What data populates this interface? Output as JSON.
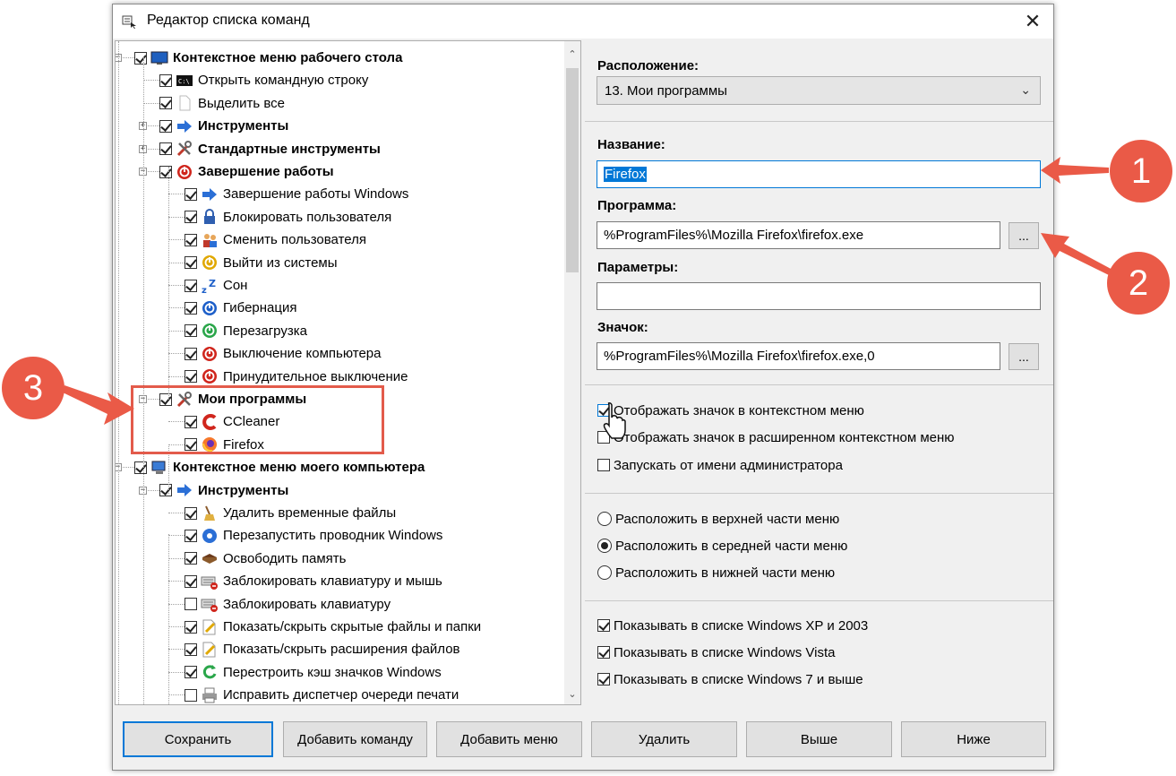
{
  "window": {
    "title": "Редактор списка команд",
    "close_glyph": "✕"
  },
  "tree": [
    {
      "label": "Контекстное меню рабочего стола",
      "bold": true,
      "checked": true,
      "level": 0,
      "expander": "−",
      "icon": "desktop-icon"
    },
    {
      "label": "Открыть командную строку",
      "bold": false,
      "checked": true,
      "level": 1,
      "icon": "cmd-icon"
    },
    {
      "label": "Выделить все",
      "bold": false,
      "checked": true,
      "level": 1,
      "icon": "document-icon"
    },
    {
      "label": "Инструменты",
      "bold": true,
      "checked": true,
      "level": 1,
      "expander": "+",
      "icon": "arrow-right-icon"
    },
    {
      "label": "Стандартные инструменты",
      "bold": true,
      "checked": true,
      "level": 1,
      "expander": "+",
      "icon": "tools-icon"
    },
    {
      "label": "Завершение работы",
      "bold": true,
      "checked": true,
      "level": 1,
      "expander": "−",
      "icon": "power-red-icon"
    },
    {
      "label": "Завершение работы Windows",
      "bold": false,
      "checked": true,
      "level": 2,
      "icon": "arrow-right-icon"
    },
    {
      "label": "Блокировать пользователя",
      "bold": false,
      "checked": true,
      "level": 2,
      "icon": "lock-icon"
    },
    {
      "label": "Сменить пользователя",
      "bold": false,
      "checked": true,
      "level": 2,
      "icon": "users-icon"
    },
    {
      "label": "Выйти из системы",
      "bold": false,
      "checked": true,
      "level": 2,
      "icon": "power-yellow-icon"
    },
    {
      "label": "Сон",
      "bold": false,
      "checked": true,
      "level": 2,
      "icon": "sleep-icon"
    },
    {
      "label": "Гибернация",
      "bold": false,
      "checked": true,
      "level": 2,
      "icon": "power-blue-icon"
    },
    {
      "label": "Перезагрузка",
      "bold": false,
      "checked": true,
      "level": 2,
      "icon": "power-green-icon"
    },
    {
      "label": "Выключение компьютера",
      "bold": false,
      "checked": true,
      "level": 2,
      "icon": "power-red-icon"
    },
    {
      "label": "Принудительное выключение",
      "bold": false,
      "checked": true,
      "level": 2,
      "icon": "power-red-icon"
    },
    {
      "label": "Мои программы",
      "bold": true,
      "checked": true,
      "level": 1,
      "expander": "−",
      "icon": "tools-icon"
    },
    {
      "label": "CCleaner",
      "bold": false,
      "checked": true,
      "level": 2,
      "icon": "ccleaner-icon"
    },
    {
      "label": "Firefox",
      "bold": false,
      "checked": true,
      "level": 2,
      "icon": "firefox-icon",
      "selected": true
    },
    {
      "label": "Контекстное меню моего компьютера",
      "bold": true,
      "checked": true,
      "level": 0,
      "expander": "−",
      "icon": "computer-icon"
    },
    {
      "label": "Инструменты",
      "bold": true,
      "checked": true,
      "level": 1,
      "expander": "−",
      "icon": "arrow-right-icon"
    },
    {
      "label": "Удалить временные файлы",
      "bold": false,
      "checked": true,
      "level": 2,
      "icon": "broom-icon"
    },
    {
      "label": "Перезапустить проводник Windows",
      "bold": false,
      "checked": true,
      "level": 2,
      "icon": "gear-blue-icon"
    },
    {
      "label": "Освободить память",
      "bold": false,
      "checked": true,
      "level": 2,
      "icon": "memory-icon"
    },
    {
      "label": "Заблокировать клавиатуру и мышь",
      "bold": false,
      "checked": true,
      "level": 2,
      "icon": "keyboard-lock-icon"
    },
    {
      "label": "Заблокировать клавиатуру",
      "bold": false,
      "checked": false,
      "level": 2,
      "icon": "keyboard-lock-icon"
    },
    {
      "label": "Показать/скрыть скрытые файлы и папки",
      "bold": false,
      "checked": true,
      "level": 2,
      "icon": "file-edit-icon"
    },
    {
      "label": "Показать/скрыть расширения файлов",
      "bold": false,
      "checked": true,
      "level": 2,
      "icon": "file-edit-icon"
    },
    {
      "label": "Перестроить кэш значков Windows",
      "bold": false,
      "checked": true,
      "level": 2,
      "icon": "refresh-green-icon"
    },
    {
      "label": "Исправить диспетчер очереди печати",
      "bold": false,
      "checked": false,
      "level": 2,
      "icon": "printer-icon"
    }
  ],
  "form": {
    "location_label": "Расположение:",
    "location_value": "13. Мои программы",
    "name_label": "Название:",
    "name_value": "Firefox",
    "program_label": "Программа:",
    "program_value": "%ProgramFiles%\\Mozilla Firefox\\firefox.exe",
    "params_label": "Параметры:",
    "params_value": "",
    "icon_label": "Значок:",
    "icon_value": "%ProgramFiles%\\Mozilla Firefox\\firefox.exe,0",
    "browse_label": "..."
  },
  "options": [
    {
      "label": "Отображать значок в контекстном меню",
      "checked": true
    },
    {
      "label": "Отображать значок в расширенном контекстном меню",
      "checked": false
    },
    {
      "label": "Запускать от имени администратора",
      "checked": false
    }
  ],
  "positions": [
    {
      "label": "Расположить в верхней части меню",
      "selected": false
    },
    {
      "label": "Расположить в середней части меню",
      "selected": true
    },
    {
      "label": "Расположить в нижней части меню",
      "selected": false
    }
  ],
  "visibility": [
    {
      "label": "Показывать в списке Windows XP и 2003",
      "checked": true
    },
    {
      "label": "Показывать в списке Windows Vista",
      "checked": true
    },
    {
      "label": "Показывать в списке Windows 7 и выше",
      "checked": true
    }
  ],
  "buttons": {
    "save": "Сохранить",
    "add_command": "Добавить команду",
    "add_menu": "Добавить меню",
    "delete": "Удалить",
    "up": "Выше",
    "down": "Ниже"
  },
  "callouts": [
    "1",
    "2",
    "3"
  ],
  "colors": {
    "accent": "#0078d7",
    "callout": "#ea5a47"
  }
}
